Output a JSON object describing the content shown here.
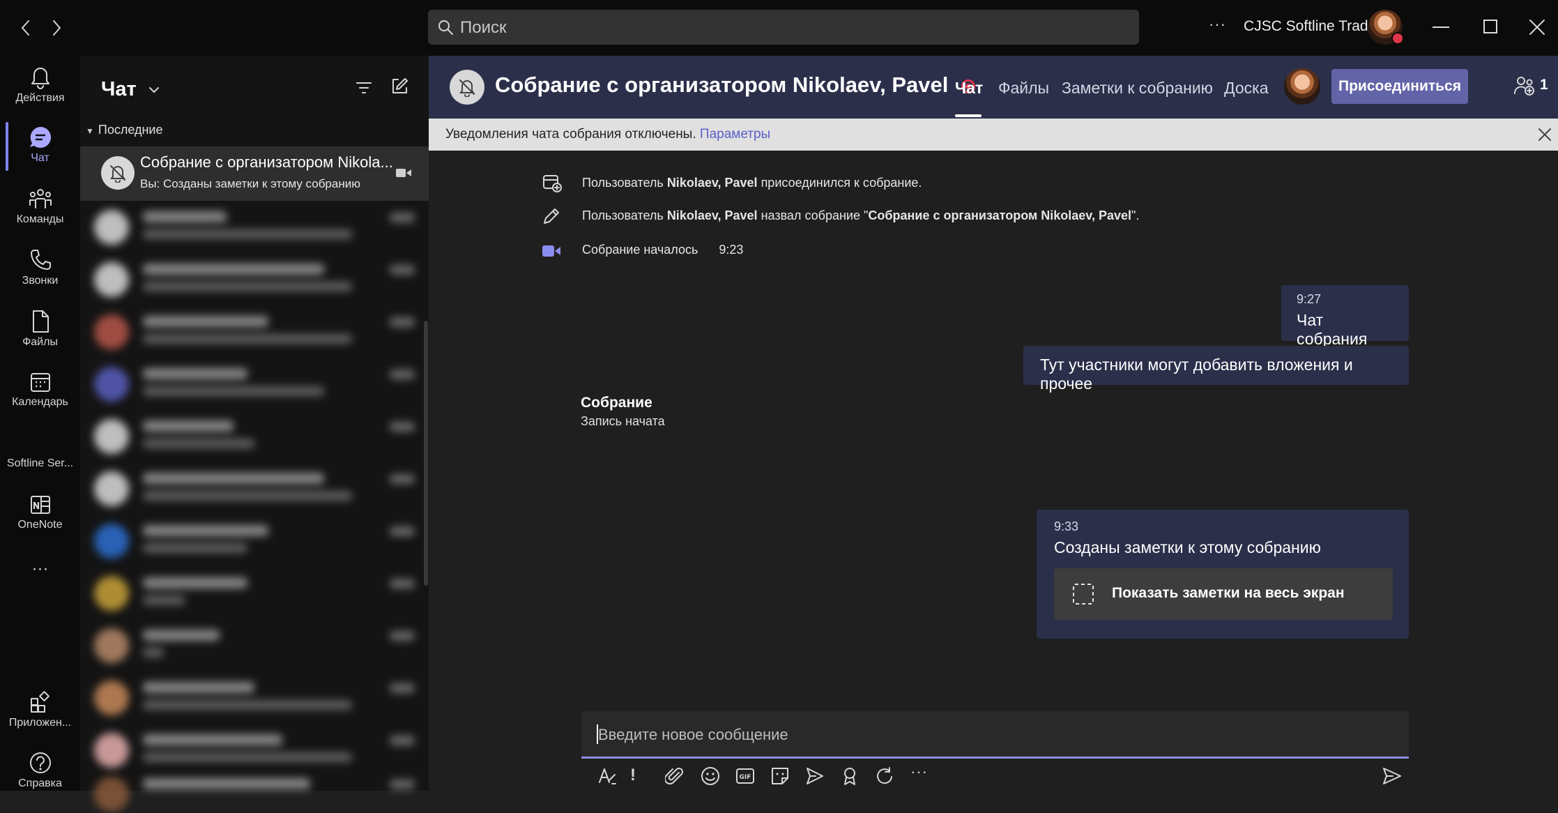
{
  "titlebar": {
    "search_placeholder": "Поиск",
    "more": "···",
    "org_name": "CJSC Softline Trade"
  },
  "rail": {
    "items": [
      {
        "label": "Действия",
        "icon": "bell-icon"
      },
      {
        "label": "Чат",
        "icon": "chat-icon",
        "active": true
      },
      {
        "label": "Команды",
        "icon": "teams-icon"
      },
      {
        "label": "Звонки",
        "icon": "phone-icon"
      },
      {
        "label": "Файлы",
        "icon": "file-icon"
      },
      {
        "label": "Календарь",
        "icon": "calendar-icon"
      },
      {
        "label": "Softline Ser...",
        "icon": "app-icon"
      },
      {
        "label": "OneNote",
        "icon": "onenote-icon"
      },
      {
        "label": "···",
        "icon": "more-icon"
      }
    ],
    "apps_label": "Приложен...",
    "help_label": "Справка"
  },
  "chatlist": {
    "title": "Чат",
    "section": "Последние",
    "selected": {
      "name": "Собрание с организатором Nikola...",
      "preview": "Вы: Созданы заметки к этому собранию"
    }
  },
  "meeting": {
    "title": "Собрание с организатором Nikolaev, Pavel",
    "tabs": [
      "Чат",
      "Файлы",
      "Заметки к собранию",
      "Доска"
    ],
    "join_label": "Присоединиться",
    "participants_count": "1"
  },
  "notification": {
    "text": "Уведомления чата собрания отключены.",
    "link": "Параметры"
  },
  "events": {
    "joined": {
      "prefix": "Пользователь ",
      "user": "Nikolaev, Pavel",
      "suffix": " присоединился к собрание."
    },
    "renamed": {
      "prefix": "Пользователь ",
      "user": "Nikolaev, Pavel",
      "middle": " назвал собрание \"",
      "name": "Собрание с организатором Nikolaev, Pavel",
      "suffix": "\"."
    },
    "started": {
      "text": "Собрание началось",
      "time": "9:23"
    }
  },
  "messages": {
    "m1": {
      "time": "9:27",
      "text": "Чат собрания"
    },
    "m2": {
      "text": "Тут участники могут добавить вложения и прочее"
    },
    "meeting_card": {
      "title": "Собрание",
      "subtitle": "Запись начата"
    },
    "m3": {
      "time": "9:33",
      "text": "Созданы заметки к этому собранию",
      "button": "Показать заметки на весь экран"
    }
  },
  "compose": {
    "placeholder": "Введите новое сообщение"
  },
  "colors": {
    "accent": "#6264a7",
    "header": "#2b2f4a",
    "recording": "#e0364b"
  }
}
